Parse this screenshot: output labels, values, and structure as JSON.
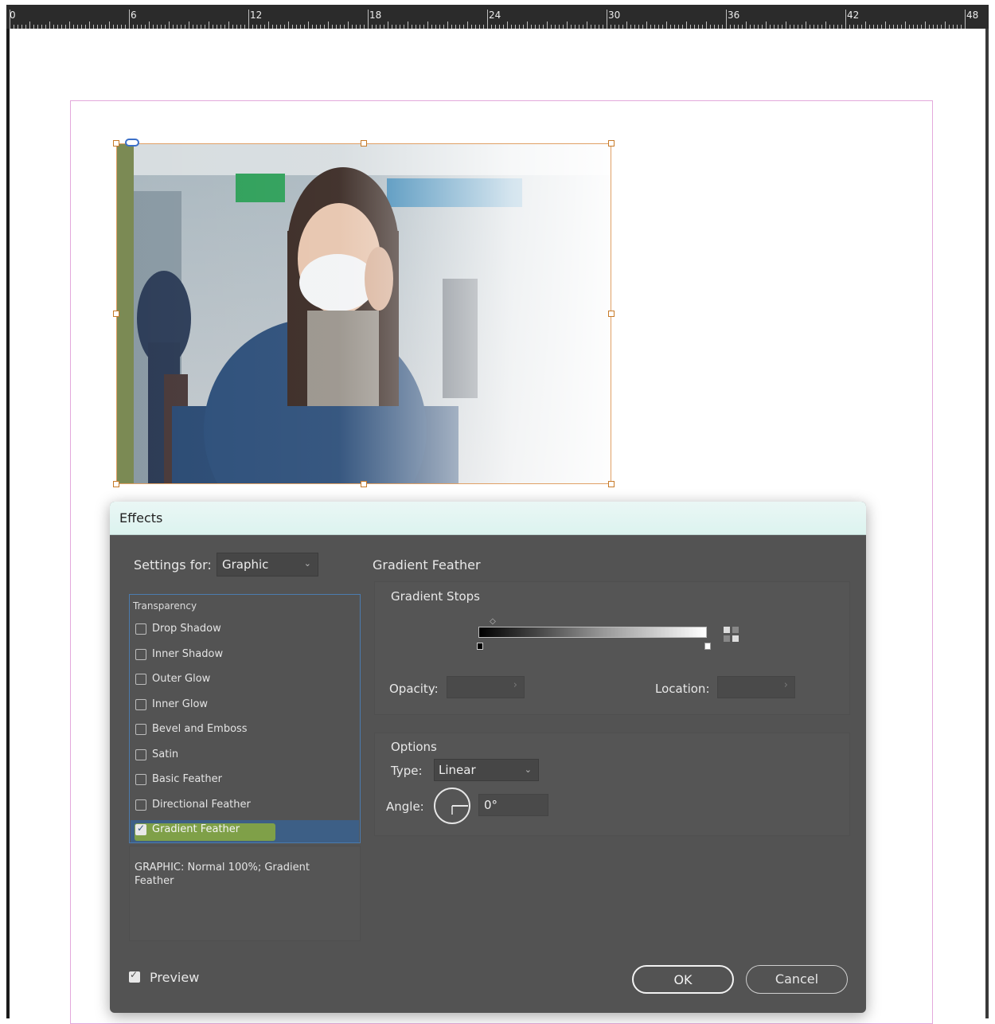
{
  "ruler": {
    "labels": [
      "0",
      "6",
      "12",
      "18",
      "24",
      "30",
      "36",
      "42",
      "48"
    ]
  },
  "dialog": {
    "title": "Effects",
    "settings_for_label": "Settings for:",
    "settings_for_value": "Graphic",
    "effects_header": "Transparency",
    "effects": [
      {
        "label": "Drop Shadow",
        "checked": false
      },
      {
        "label": "Inner Shadow",
        "checked": false
      },
      {
        "label": "Outer Glow",
        "checked": false
      },
      {
        "label": "Inner Glow",
        "checked": false
      },
      {
        "label": "Bevel and Emboss",
        "checked": false
      },
      {
        "label": "Satin",
        "checked": false
      },
      {
        "label": "Basic Feather",
        "checked": false
      },
      {
        "label": "Directional Feather",
        "checked": false
      },
      {
        "label": "Gradient Feather",
        "checked": true
      }
    ],
    "summary": "GRAPHIC: Normal 100%; Gradient Feather",
    "section_title": "Gradient Feather",
    "gradient_stops_label": "Gradient Stops",
    "opacity_label": "Opacity:",
    "location_label": "Location:",
    "options_label": "Options",
    "type_label": "Type:",
    "type_value": "Linear",
    "angle_label": "Angle:",
    "angle_value": "0°",
    "preview_label": "Preview",
    "preview_checked": true,
    "ok_label": "OK",
    "cancel_label": "Cancel"
  },
  "colors": {
    "dialog_bg": "#535353",
    "title_bar": "#dcf3ef",
    "selection": "#3d5f86",
    "highlight": "#b7d615",
    "frame": "#e0a065",
    "margin_guide": "#e3a9dc"
  }
}
